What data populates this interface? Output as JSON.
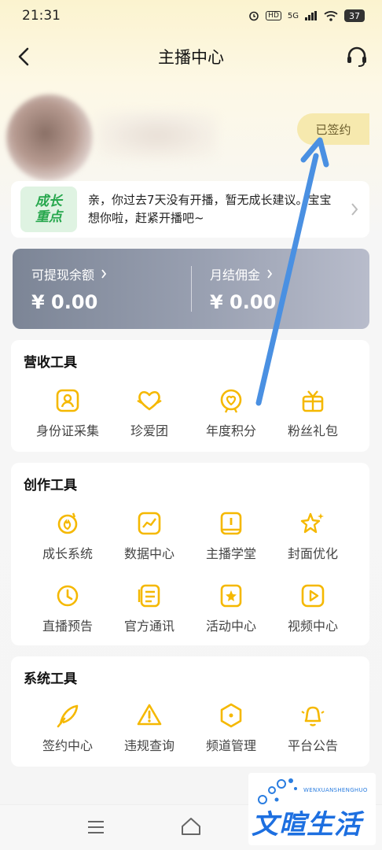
{
  "status_bar": {
    "time": "21:31",
    "battery": "37",
    "network": "5G",
    "hd": "HD"
  },
  "nav": {
    "title": "主播中心"
  },
  "profile": {
    "signed_badge": "已签约"
  },
  "growth": {
    "badge_line1": "成长",
    "badge_line2": "重点",
    "message": "亲，你过去7天没有开播，暂无成长建议。宝宝想你啦，赶紧开播吧~"
  },
  "balance": {
    "withdrawable_label": "可提现余额",
    "withdrawable_value": "¥ 0.00",
    "monthly_label": "月结佣金",
    "monthly_value": "¥ 0.00"
  },
  "revenue_tools": {
    "title": "营收工具",
    "items": [
      "身份证采集",
      "珍爱团",
      "年度积分",
      "粉丝礼包"
    ]
  },
  "creation_tools": {
    "title": "创作工具",
    "items": [
      "成长系统",
      "数据中心",
      "主播学堂",
      "封面优化",
      "直播预告",
      "官方通讯",
      "活动中心",
      "视频中心"
    ]
  },
  "system_tools": {
    "title": "系统工具",
    "items": [
      "签约中心",
      "违规查询",
      "频道管理",
      "平台公告"
    ]
  },
  "watermark": {
    "sub": "WENXUANSHENGHUO",
    "main": "文暄生活"
  },
  "colors": {
    "accent": "#f5b800",
    "growth_green": "#27a74d",
    "annotation_arrow": "#4a90e2"
  },
  "icons": {
    "revenue": [
      "id-card-icon",
      "heart-group-icon",
      "badge-icon",
      "gift-icon"
    ],
    "creation": [
      "growth-flame-icon",
      "data-chart-icon",
      "book-icon",
      "star-sparkle-icon",
      "clock-icon",
      "news-list-icon",
      "bookmark-star-icon",
      "video-play-icon"
    ],
    "system": [
      "quill-icon",
      "warning-icon",
      "hexagon-icon",
      "bell-icon"
    ]
  }
}
